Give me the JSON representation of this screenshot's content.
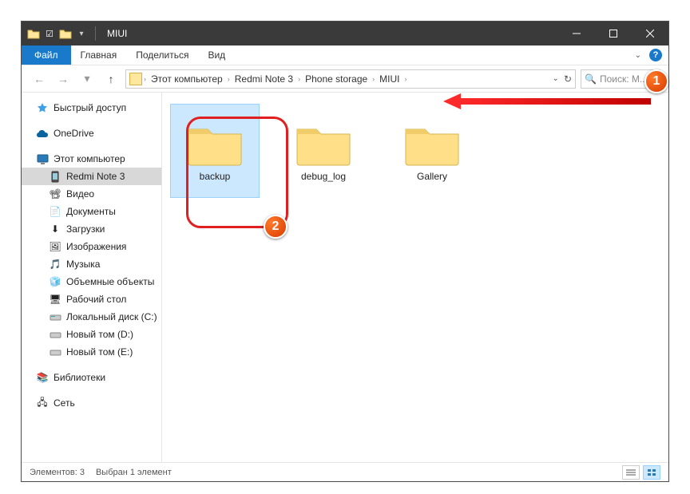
{
  "title": "MIUI",
  "ribbon": {
    "file": "Файл",
    "tabs": [
      "Главная",
      "Поделиться",
      "Вид"
    ]
  },
  "breadcrumbs": [
    "Этот компьютер",
    "Redmi Note 3",
    "Phone storage",
    "MIUI"
  ],
  "search_placeholder": "Поиск: M...",
  "sidebar": {
    "quick": "Быстрый доступ",
    "onedrive": "OneDrive",
    "thispc": "Этот компьютер",
    "items": [
      "Redmi Note 3",
      "Видео",
      "Документы",
      "Загрузки",
      "Изображения",
      "Музыка",
      "Объемные объекты",
      "Рабочий стол",
      "Локальный диск (C:)",
      "Новый том (D:)",
      "Новый том (E:)"
    ],
    "libraries": "Библиотеки",
    "network": "Сеть"
  },
  "folders": [
    "backup",
    "debug_log",
    "Gallery"
  ],
  "status": {
    "count": "Элементов: 3",
    "selected": "Выбран 1 элемент"
  },
  "annotations": {
    "badge1": "1",
    "badge2": "2"
  }
}
